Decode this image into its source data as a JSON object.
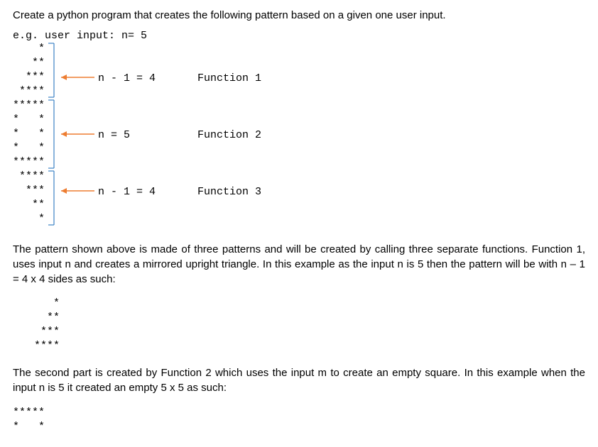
{
  "intro": "Create a python program that creates the following pattern based on a given one user input.",
  "eg": "e.g. user input: n= 5",
  "diagram": {
    "pattern": "    *\n   **\n  ***\n ****\n*****\n*   *\n*   *\n*   *\n*****\n ****\n  ***\n   **\n    *",
    "anno1_label": "n - 1 = 4",
    "anno1_func": "Function 1",
    "anno2_label": "n = 5",
    "anno2_func": "Function 2",
    "anno3_label": "n - 1 = 4",
    "anno3_func": "Function 3"
  },
  "explain1": "The pattern shown above is made of three patterns and will be created by calling three separate functions. Function 1, uses input n and creates a mirrored upright triangle. In this example as the input n is 5 then the pattern will be with n – 1 = 4 x 4 sides as such:",
  "triangle_sample": "   *\n  **\n ***\n****",
  "explain2": "The second part is created by Function 2 which uses the input m to create an empty square. In this example when the input n is 5 it created an empty 5 x 5 as such:",
  "square_sample": "*****\n*   *"
}
